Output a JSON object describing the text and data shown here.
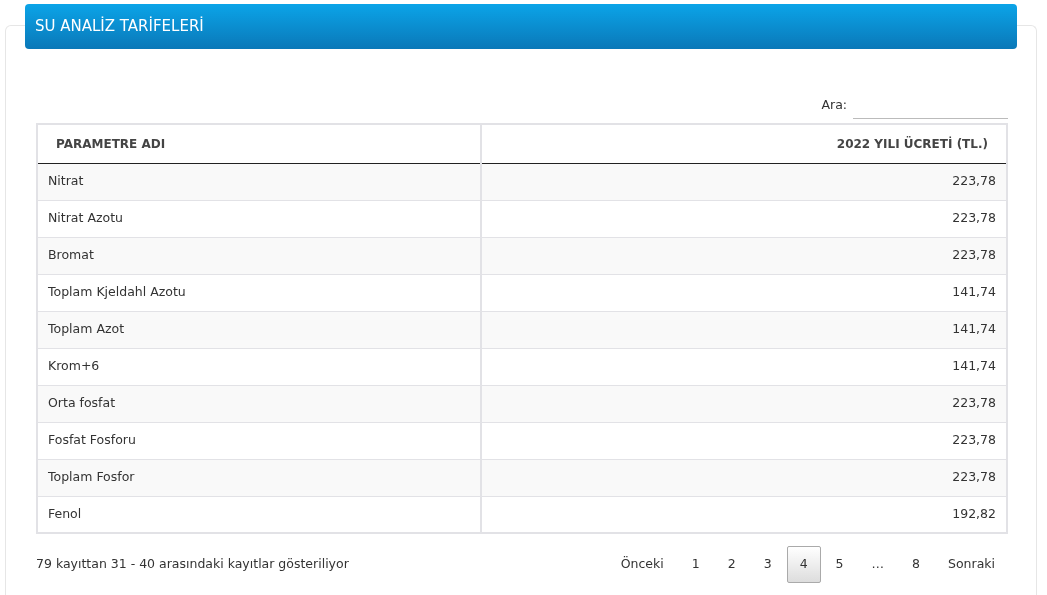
{
  "panel": {
    "title": "SU ANALİZ TARİFELERİ"
  },
  "search": {
    "label": "Ara:"
  },
  "table": {
    "columns": [
      "PARAMETRE ADI",
      "2022 YILI ÜCRETİ (TL.)"
    ],
    "rows": [
      [
        "Nitrat",
        "223,78"
      ],
      [
        "Nitrat Azotu",
        "223,78"
      ],
      [
        "Bromat",
        "223,78"
      ],
      [
        "Toplam Kjeldahl Azotu",
        "141,74"
      ],
      [
        "Toplam Azot",
        "141,74"
      ],
      [
        "Krom+6",
        "141,74"
      ],
      [
        "Orta fosfat",
        "223,78"
      ],
      [
        "Fosfat Fosforu",
        "223,78"
      ],
      [
        "Toplam Fosfor",
        "223,78"
      ],
      [
        "Fenol",
        "192,82"
      ]
    ]
  },
  "info": "79 kayıttan 31 - 40 arasındaki kayıtlar gösteriliyor",
  "pagination": [
    {
      "label": "Önceki",
      "kind": "link",
      "selected": false
    },
    {
      "label": "1",
      "kind": "link",
      "selected": false
    },
    {
      "label": "2",
      "kind": "link",
      "selected": false
    },
    {
      "label": "3",
      "kind": "link",
      "selected": false
    },
    {
      "label": "4",
      "kind": "link",
      "selected": true
    },
    {
      "label": "5",
      "kind": "link",
      "selected": false
    },
    {
      "label": "…",
      "kind": "ellipsis"
    },
    {
      "label": "8",
      "kind": "link",
      "selected": false
    },
    {
      "label": "Sonraki",
      "kind": "link",
      "selected": false
    }
  ]
}
